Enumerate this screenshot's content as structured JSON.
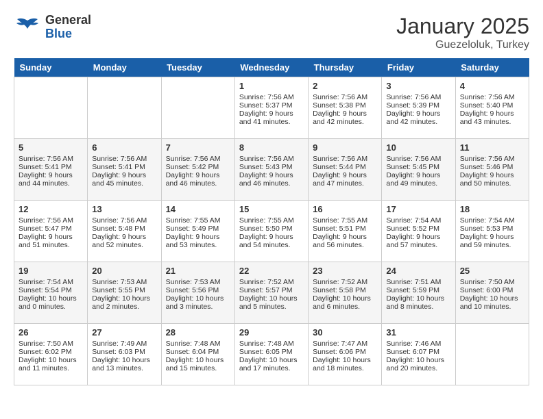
{
  "header": {
    "logo_general": "General",
    "logo_blue": "Blue",
    "month_year": "January 2025",
    "location": "Guezeloluk, Turkey"
  },
  "weekdays": [
    "Sunday",
    "Monday",
    "Tuesday",
    "Wednesday",
    "Thursday",
    "Friday",
    "Saturday"
  ],
  "weeks": [
    [
      {
        "day": "",
        "text": ""
      },
      {
        "day": "",
        "text": ""
      },
      {
        "day": "",
        "text": ""
      },
      {
        "day": "1",
        "text": "Sunrise: 7:56 AM\nSunset: 5:37 PM\nDaylight: 9 hours and 41 minutes."
      },
      {
        "day": "2",
        "text": "Sunrise: 7:56 AM\nSunset: 5:38 PM\nDaylight: 9 hours and 42 minutes."
      },
      {
        "day": "3",
        "text": "Sunrise: 7:56 AM\nSunset: 5:39 PM\nDaylight: 9 hours and 42 minutes."
      },
      {
        "day": "4",
        "text": "Sunrise: 7:56 AM\nSunset: 5:40 PM\nDaylight: 9 hours and 43 minutes."
      }
    ],
    [
      {
        "day": "5",
        "text": "Sunrise: 7:56 AM\nSunset: 5:41 PM\nDaylight: 9 hours and 44 minutes."
      },
      {
        "day": "6",
        "text": "Sunrise: 7:56 AM\nSunset: 5:41 PM\nDaylight: 9 hours and 45 minutes."
      },
      {
        "day": "7",
        "text": "Sunrise: 7:56 AM\nSunset: 5:42 PM\nDaylight: 9 hours and 46 minutes."
      },
      {
        "day": "8",
        "text": "Sunrise: 7:56 AM\nSunset: 5:43 PM\nDaylight: 9 hours and 46 minutes."
      },
      {
        "day": "9",
        "text": "Sunrise: 7:56 AM\nSunset: 5:44 PM\nDaylight: 9 hours and 47 minutes."
      },
      {
        "day": "10",
        "text": "Sunrise: 7:56 AM\nSunset: 5:45 PM\nDaylight: 9 hours and 49 minutes."
      },
      {
        "day": "11",
        "text": "Sunrise: 7:56 AM\nSunset: 5:46 PM\nDaylight: 9 hours and 50 minutes."
      }
    ],
    [
      {
        "day": "12",
        "text": "Sunrise: 7:56 AM\nSunset: 5:47 PM\nDaylight: 9 hours and 51 minutes."
      },
      {
        "day": "13",
        "text": "Sunrise: 7:56 AM\nSunset: 5:48 PM\nDaylight: 9 hours and 52 minutes."
      },
      {
        "day": "14",
        "text": "Sunrise: 7:55 AM\nSunset: 5:49 PM\nDaylight: 9 hours and 53 minutes."
      },
      {
        "day": "15",
        "text": "Sunrise: 7:55 AM\nSunset: 5:50 PM\nDaylight: 9 hours and 54 minutes."
      },
      {
        "day": "16",
        "text": "Sunrise: 7:55 AM\nSunset: 5:51 PM\nDaylight: 9 hours and 56 minutes."
      },
      {
        "day": "17",
        "text": "Sunrise: 7:54 AM\nSunset: 5:52 PM\nDaylight: 9 hours and 57 minutes."
      },
      {
        "day": "18",
        "text": "Sunrise: 7:54 AM\nSunset: 5:53 PM\nDaylight: 9 hours and 59 minutes."
      }
    ],
    [
      {
        "day": "19",
        "text": "Sunrise: 7:54 AM\nSunset: 5:54 PM\nDaylight: 10 hours and 0 minutes."
      },
      {
        "day": "20",
        "text": "Sunrise: 7:53 AM\nSunset: 5:55 PM\nDaylight: 10 hours and 2 minutes."
      },
      {
        "day": "21",
        "text": "Sunrise: 7:53 AM\nSunset: 5:56 PM\nDaylight: 10 hours and 3 minutes."
      },
      {
        "day": "22",
        "text": "Sunrise: 7:52 AM\nSunset: 5:57 PM\nDaylight: 10 hours and 5 minutes."
      },
      {
        "day": "23",
        "text": "Sunrise: 7:52 AM\nSunset: 5:58 PM\nDaylight: 10 hours and 6 minutes."
      },
      {
        "day": "24",
        "text": "Sunrise: 7:51 AM\nSunset: 5:59 PM\nDaylight: 10 hours and 8 minutes."
      },
      {
        "day": "25",
        "text": "Sunrise: 7:50 AM\nSunset: 6:00 PM\nDaylight: 10 hours and 10 minutes."
      }
    ],
    [
      {
        "day": "26",
        "text": "Sunrise: 7:50 AM\nSunset: 6:02 PM\nDaylight: 10 hours and 11 minutes."
      },
      {
        "day": "27",
        "text": "Sunrise: 7:49 AM\nSunset: 6:03 PM\nDaylight: 10 hours and 13 minutes."
      },
      {
        "day": "28",
        "text": "Sunrise: 7:48 AM\nSunset: 6:04 PM\nDaylight: 10 hours and 15 minutes."
      },
      {
        "day": "29",
        "text": "Sunrise: 7:48 AM\nSunset: 6:05 PM\nDaylight: 10 hours and 17 minutes."
      },
      {
        "day": "30",
        "text": "Sunrise: 7:47 AM\nSunset: 6:06 PM\nDaylight: 10 hours and 18 minutes."
      },
      {
        "day": "31",
        "text": "Sunrise: 7:46 AM\nSunset: 6:07 PM\nDaylight: 10 hours and 20 minutes."
      },
      {
        "day": "",
        "text": ""
      }
    ]
  ]
}
